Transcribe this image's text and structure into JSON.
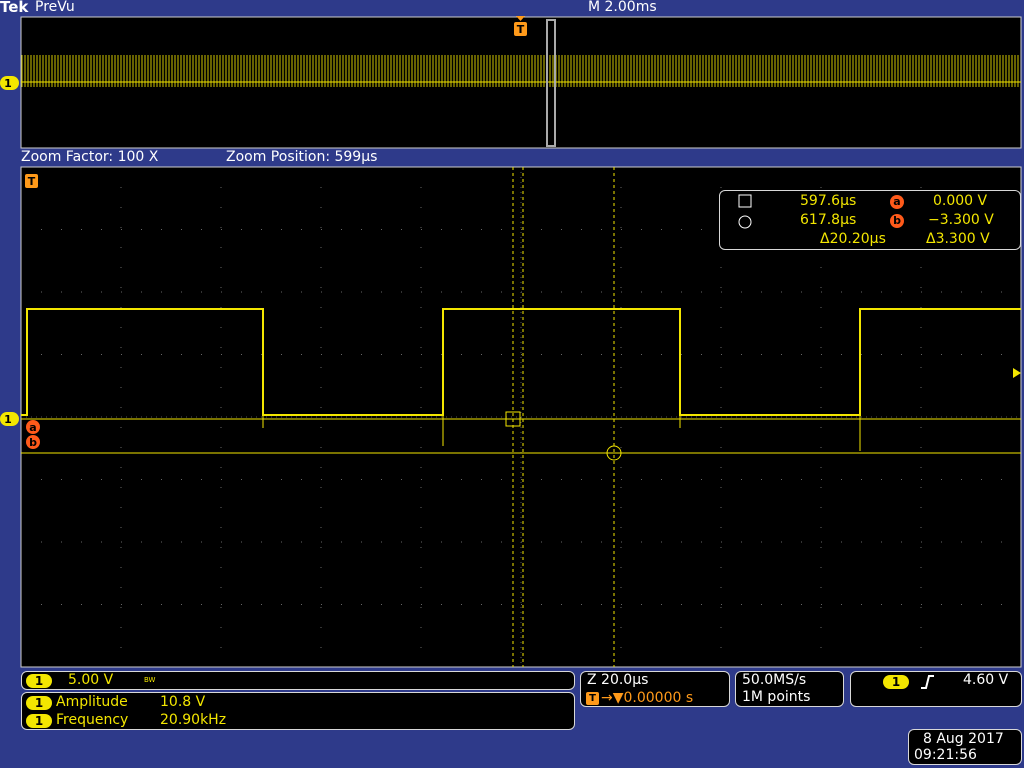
{
  "header": {
    "brand": "Tek",
    "mode": "PreVu",
    "timebase": "M 2.00ms"
  },
  "zoom": {
    "factor": "Zoom Factor: 100 X",
    "position": "Zoom Position: 599µs"
  },
  "cursors": {
    "a_time": "597.6µs",
    "a_label": "a",
    "a_value": "0.000 V",
    "b_time": "617.8µs",
    "b_label": "b",
    "b_value": "−3.300 V",
    "delta_time": "Δ20.20µs",
    "delta_value": "Δ3.300 V"
  },
  "markers": {
    "channel": "1",
    "trigger": "T",
    "cursor_a": "a",
    "cursor_b": "b"
  },
  "channel_readout": {
    "channel": "1",
    "scale": "5.00 V",
    "bw": "BW"
  },
  "measurements": [
    {
      "channel": "1",
      "name": "Amplitude",
      "value": "10.8 V"
    },
    {
      "channel": "1",
      "name": "Frequency",
      "value": "20.90kHz"
    }
  ],
  "horizontal": {
    "zoom_scale": "Z 20.0µs",
    "trigger_delay": "→▼0.00000 s"
  },
  "acquisition": {
    "rate": "50.0MS/s",
    "points": "1M points"
  },
  "trigger": {
    "channel": "1",
    "slope": "rising",
    "level": "4.60 V"
  },
  "datetime": {
    "date": "8 Aug 2017",
    "time": "09:21:56"
  },
  "colors": {
    "trace": "#f3e600",
    "background": "#2e3a8a",
    "cursor_accent": "#ff5a1a",
    "trigger": "#ff9a1a"
  }
}
